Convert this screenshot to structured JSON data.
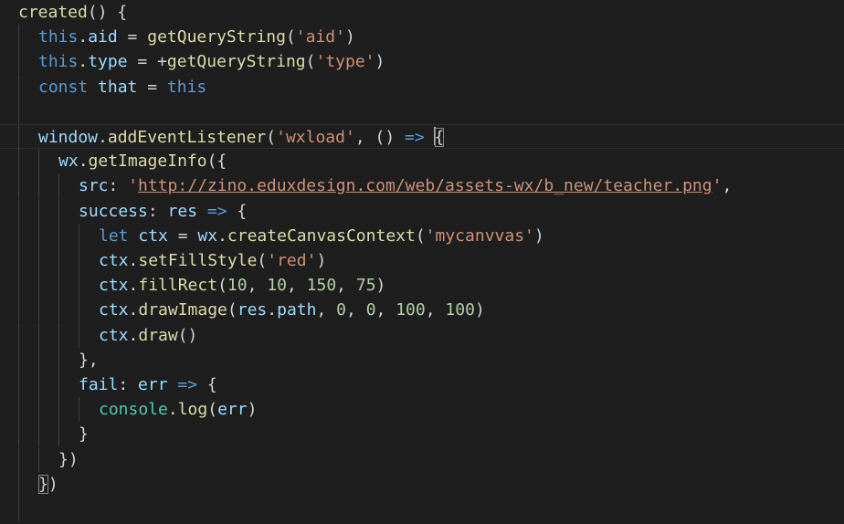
{
  "editor": {
    "language": "javascript",
    "lines": [
      {
        "indent": 0,
        "current": false,
        "tokens": [
          {
            "t": "created",
            "c": "fn"
          },
          {
            "t": "() {",
            "c": "pun"
          }
        ]
      },
      {
        "indent": 1,
        "current": false,
        "tokens": [
          {
            "t": "this",
            "c": "kw"
          },
          {
            "t": ".",
            "c": "pun"
          },
          {
            "t": "aid",
            "c": "var"
          },
          {
            "t": " = ",
            "c": "pun"
          },
          {
            "t": "getQueryString",
            "c": "fn"
          },
          {
            "t": "(",
            "c": "pun"
          },
          {
            "t": "'aid'",
            "c": "str"
          },
          {
            "t": ")",
            "c": "pun"
          }
        ]
      },
      {
        "indent": 1,
        "current": false,
        "tokens": [
          {
            "t": "this",
            "c": "kw"
          },
          {
            "t": ".",
            "c": "pun"
          },
          {
            "t": "type",
            "c": "var"
          },
          {
            "t": " = +",
            "c": "pun"
          },
          {
            "t": "getQueryString",
            "c": "fn"
          },
          {
            "t": "(",
            "c": "pun"
          },
          {
            "t": "'type'",
            "c": "str"
          },
          {
            "t": ")",
            "c": "pun"
          }
        ]
      },
      {
        "indent": 1,
        "current": false,
        "tokens": [
          {
            "t": "const",
            "c": "kw"
          },
          {
            "t": " ",
            "c": "pun"
          },
          {
            "t": "that",
            "c": "var"
          },
          {
            "t": " = ",
            "c": "pun"
          },
          {
            "t": "this",
            "c": "kw"
          }
        ]
      },
      {
        "indent": 1,
        "current": false,
        "tokens": []
      },
      {
        "indent": 1,
        "current": true,
        "tokens": [
          {
            "t": "window",
            "c": "var"
          },
          {
            "t": ".",
            "c": "pun"
          },
          {
            "t": "addEventListener",
            "c": "fn"
          },
          {
            "t": "(",
            "c": "pun"
          },
          {
            "t": "'wxload'",
            "c": "str"
          },
          {
            "t": ", () ",
            "c": "pun"
          },
          {
            "t": "=>",
            "c": "kw"
          },
          {
            "t": " ",
            "c": "pun"
          },
          {
            "t": "{",
            "c": "pun",
            "match": true,
            "cursor": true
          }
        ]
      },
      {
        "indent": 2,
        "current": false,
        "tokens": [
          {
            "t": "wx",
            "c": "var"
          },
          {
            "t": ".",
            "c": "pun"
          },
          {
            "t": "getImageInfo",
            "c": "fn"
          },
          {
            "t": "({",
            "c": "pun"
          }
        ]
      },
      {
        "indent": 3,
        "current": false,
        "tokens": [
          {
            "t": "src",
            "c": "var"
          },
          {
            "t": ": ",
            "c": "pun"
          },
          {
            "t": "'",
            "c": "str"
          },
          {
            "t": "http://zino.eduxdesign.com/web/assets-wx/b_new/teacher.png",
            "c": "str",
            "url": true
          },
          {
            "t": "'",
            "c": "str"
          },
          {
            "t": ",",
            "c": "pun"
          }
        ]
      },
      {
        "indent": 3,
        "current": false,
        "tokens": [
          {
            "t": "success",
            "c": "var"
          },
          {
            "t": ": ",
            "c": "pun"
          },
          {
            "t": "res",
            "c": "var"
          },
          {
            "t": " ",
            "c": "pun"
          },
          {
            "t": "=>",
            "c": "kw"
          },
          {
            "t": " {",
            "c": "pun"
          }
        ]
      },
      {
        "indent": 4,
        "current": false,
        "tokens": [
          {
            "t": "let",
            "c": "kw"
          },
          {
            "t": " ",
            "c": "pun"
          },
          {
            "t": "ctx",
            "c": "var"
          },
          {
            "t": " = ",
            "c": "pun"
          },
          {
            "t": "wx",
            "c": "var"
          },
          {
            "t": ".",
            "c": "pun"
          },
          {
            "t": "createCanvasContext",
            "c": "fn"
          },
          {
            "t": "(",
            "c": "pun"
          },
          {
            "t": "'mycanvvas'",
            "c": "str"
          },
          {
            "t": ")",
            "c": "pun"
          }
        ]
      },
      {
        "indent": 4,
        "current": false,
        "tokens": [
          {
            "t": "ctx",
            "c": "var"
          },
          {
            "t": ".",
            "c": "pun"
          },
          {
            "t": "setFillStyle",
            "c": "fn"
          },
          {
            "t": "(",
            "c": "pun"
          },
          {
            "t": "'red'",
            "c": "str"
          },
          {
            "t": ")",
            "c": "pun"
          }
        ]
      },
      {
        "indent": 4,
        "current": false,
        "tokens": [
          {
            "t": "ctx",
            "c": "var"
          },
          {
            "t": ".",
            "c": "pun"
          },
          {
            "t": "fillRect",
            "c": "fn"
          },
          {
            "t": "(",
            "c": "pun"
          },
          {
            "t": "10",
            "c": "num"
          },
          {
            "t": ", ",
            "c": "pun"
          },
          {
            "t": "10",
            "c": "num"
          },
          {
            "t": ", ",
            "c": "pun"
          },
          {
            "t": "150",
            "c": "num"
          },
          {
            "t": ", ",
            "c": "pun"
          },
          {
            "t": "75",
            "c": "num"
          },
          {
            "t": ")",
            "c": "pun"
          }
        ]
      },
      {
        "indent": 4,
        "current": false,
        "tokens": [
          {
            "t": "ctx",
            "c": "var"
          },
          {
            "t": ".",
            "c": "pun"
          },
          {
            "t": "drawImage",
            "c": "fn"
          },
          {
            "t": "(",
            "c": "pun"
          },
          {
            "t": "res",
            "c": "var"
          },
          {
            "t": ".",
            "c": "pun"
          },
          {
            "t": "path",
            "c": "var"
          },
          {
            "t": ", ",
            "c": "pun"
          },
          {
            "t": "0",
            "c": "num"
          },
          {
            "t": ", ",
            "c": "pun"
          },
          {
            "t": "0",
            "c": "num"
          },
          {
            "t": ", ",
            "c": "pun"
          },
          {
            "t": "100",
            "c": "num"
          },
          {
            "t": ", ",
            "c": "pun"
          },
          {
            "t": "100",
            "c": "num"
          },
          {
            "t": ")",
            "c": "pun"
          }
        ]
      },
      {
        "indent": 4,
        "current": false,
        "tokens": [
          {
            "t": "ctx",
            "c": "var"
          },
          {
            "t": ".",
            "c": "pun"
          },
          {
            "t": "draw",
            "c": "fn"
          },
          {
            "t": "()",
            "c": "pun"
          }
        ]
      },
      {
        "indent": 3,
        "current": false,
        "tokens": [
          {
            "t": "},",
            "c": "pun"
          }
        ]
      },
      {
        "indent": 3,
        "current": false,
        "tokens": [
          {
            "t": "fail",
            "c": "var"
          },
          {
            "t": ": ",
            "c": "pun"
          },
          {
            "t": "err",
            "c": "var"
          },
          {
            "t": " ",
            "c": "pun"
          },
          {
            "t": "=>",
            "c": "kw"
          },
          {
            "t": " {",
            "c": "pun"
          }
        ]
      },
      {
        "indent": 4,
        "current": false,
        "tokens": [
          {
            "t": "console",
            "c": "typ"
          },
          {
            "t": ".",
            "c": "pun"
          },
          {
            "t": "log",
            "c": "fn"
          },
          {
            "t": "(",
            "c": "pun"
          },
          {
            "t": "err",
            "c": "var"
          },
          {
            "t": ")",
            "c": "pun"
          }
        ]
      },
      {
        "indent": 3,
        "current": false,
        "tokens": [
          {
            "t": "}",
            "c": "pun"
          }
        ]
      },
      {
        "indent": 2,
        "current": false,
        "tokens": [
          {
            "t": "})",
            "c": "pun"
          }
        ]
      },
      {
        "indent": 1,
        "current": false,
        "tokens": [
          {
            "t": "}",
            "c": "pun",
            "match": true
          },
          {
            "t": ")",
            "c": "pun"
          }
        ]
      },
      {
        "indent": 1,
        "current": false,
        "tokens": []
      }
    ]
  },
  "colors": {
    "background": "#1e1e1e",
    "keyword": "#569cd6",
    "function": "#dcdcaa",
    "variable": "#9cdcfe",
    "string": "#ce9178",
    "number": "#b5cea8",
    "punctuation": "#d4d4d4",
    "type": "#4ec9b0"
  }
}
